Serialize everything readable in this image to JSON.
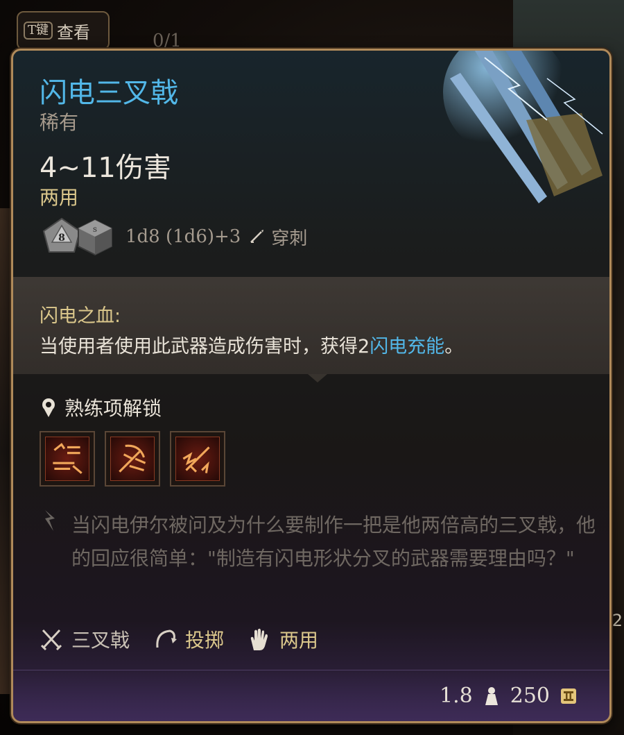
{
  "background": {
    "tab_key": "T键",
    "tab_label": "查看",
    "counter": "0/1",
    "edge_number": "2"
  },
  "item": {
    "name": "闪电三叉戟",
    "rarity": "稀有",
    "damage": "4~11伤害",
    "handedness": "两用",
    "dice": [
      "8",
      "s"
    ],
    "dice_formula": "1d8 (1d6)+3",
    "damage_type": "穿刺",
    "name_color": "#52b7e8"
  },
  "passive": {
    "name": "闪电之血:",
    "desc_before": "当使用者使用此武器造成伤害时，获得2",
    "desc_highlight": "闪电充能",
    "desc_after": "。"
  },
  "proficiency": {
    "label": "熟练项解锁",
    "actions": [
      "action-icon-1",
      "action-icon-2",
      "action-icon-3"
    ]
  },
  "flavor_text": "当闪电伊尔被问及为什么要制作一把是他两倍高的三叉戟，他的回应很简单：\"制造有闪电形状分叉的武器需要理由吗？\"",
  "properties": [
    {
      "icon": "crossed-weapons-icon",
      "label": "三叉戟"
    },
    {
      "icon": "throw-icon",
      "label": "投掷"
    },
    {
      "icon": "hand-icon",
      "label": "两用"
    }
  ],
  "footer": {
    "weight": "1.8",
    "value": "250"
  }
}
